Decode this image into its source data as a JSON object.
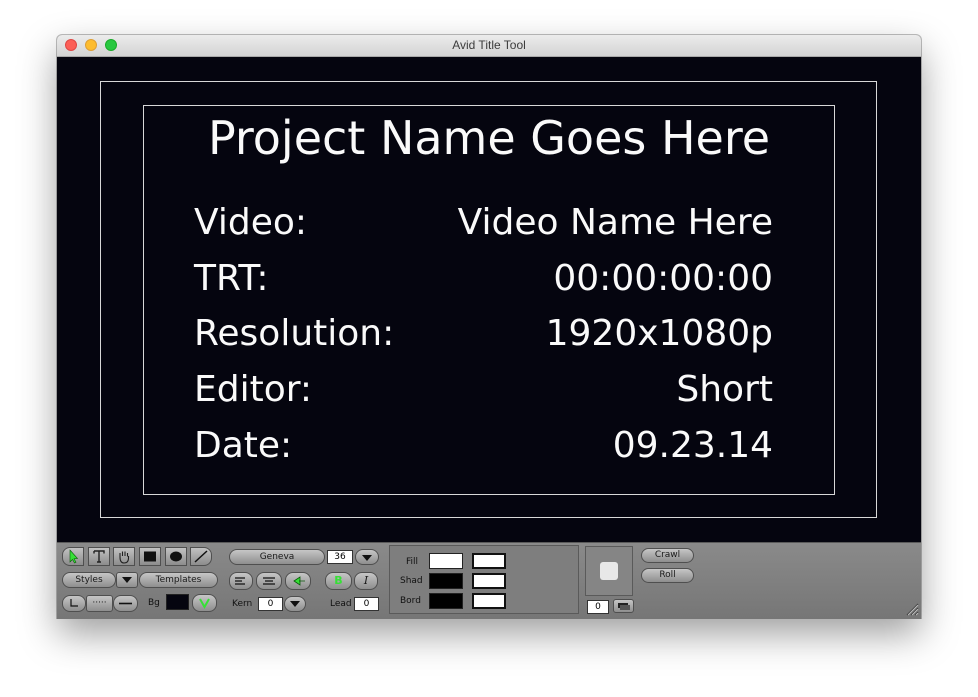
{
  "window": {
    "title": "Avid Title Tool"
  },
  "slate": {
    "title": "Project Name Goes Here",
    "rows": [
      {
        "label": "Video:",
        "value": "Video Name Here"
      },
      {
        "label": "TRT:",
        "value": "00:00:00:00"
      },
      {
        "label": "Resolution:",
        "value": "1920x1080p"
      },
      {
        "label": "Editor:",
        "value": "Short"
      },
      {
        "label": "Date:",
        "value": "09.23.14"
      }
    ]
  },
  "toolbar": {
    "font_name": "Geneva",
    "font_size": "36",
    "styles_label": "Styles",
    "templates_label": "Templates",
    "bg_label": "Bg",
    "bold_label": "B",
    "italic_label": "I",
    "kern_label": "Kern",
    "kern_value": "0",
    "lead_label": "Lead",
    "lead_value": "0",
    "line_dash_label": "·····",
    "fill_label": "Fill",
    "shad_label": "Shad",
    "bord_label": "Bord",
    "crawl_label": "Crawl",
    "roll_label": "Roll",
    "depth_value": "0"
  },
  "colors": {
    "canvas_bg": "#05050f",
    "text": "#fafafa",
    "safe_guides": "#d8d8d8",
    "active_tool": "#36e036"
  }
}
